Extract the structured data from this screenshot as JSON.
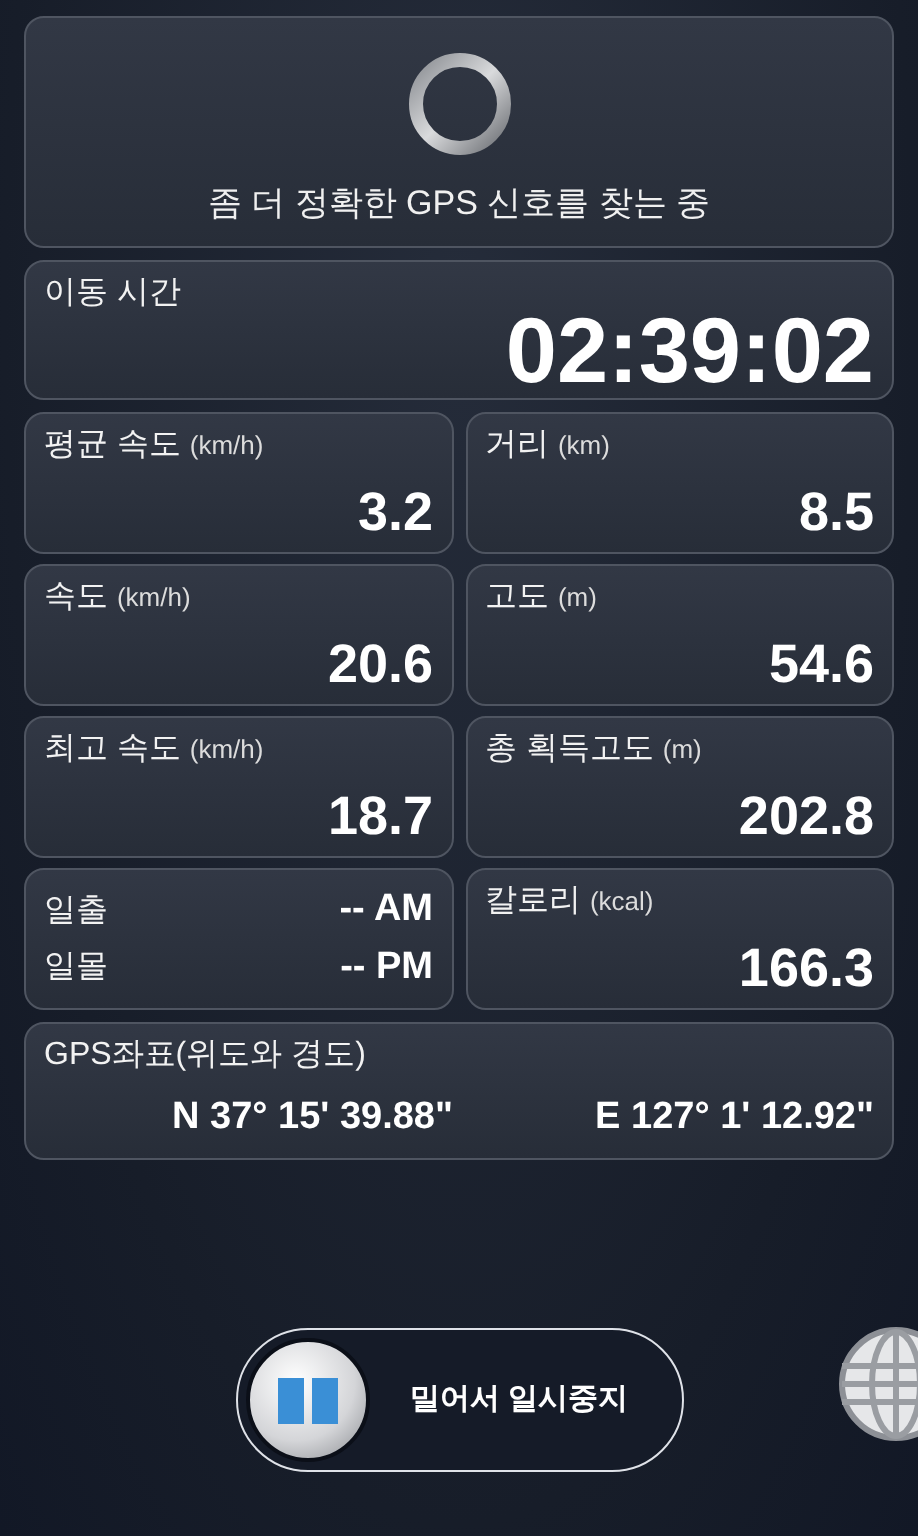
{
  "status": {
    "message": "좀 더 정확한 GPS 신호를 찾는 중"
  },
  "moving_time": {
    "label": "이동 시간",
    "value": "02:39:02"
  },
  "stats": [
    {
      "kind": "metric",
      "label": "평균 속도",
      "unit": "(km/h)",
      "value": "3.2"
    },
    {
      "kind": "metric",
      "label": "거리",
      "unit": "(km)",
      "value": "8.5"
    },
    {
      "kind": "metric",
      "label": "속도",
      "unit": "(km/h)",
      "value": "20.6"
    },
    {
      "kind": "metric",
      "label": "고도",
      "unit": "(m)",
      "value": "54.6"
    },
    {
      "kind": "metric",
      "label": "최고 속도",
      "unit": "(km/h)",
      "value": "18.7"
    },
    {
      "kind": "metric",
      "label": "총 획득고도",
      "unit": "(m)",
      "value": "202.8"
    },
    {
      "kind": "sun",
      "rows": [
        {
          "label": "일출",
          "value": "-- AM"
        },
        {
          "label": "일몰",
          "value": "-- PM"
        }
      ]
    },
    {
      "kind": "metric",
      "label": "칼로리",
      "unit": "(kcal)",
      "value": "166.3"
    }
  ],
  "gps": {
    "label": "GPS좌표(위도와 경도)",
    "latitude": "N 37° 15' 39.88\"",
    "longitude": "E 127° 1' 12.92\""
  },
  "pause_slider": {
    "label": "밀어서 일시중지",
    "level": 0
  }
}
